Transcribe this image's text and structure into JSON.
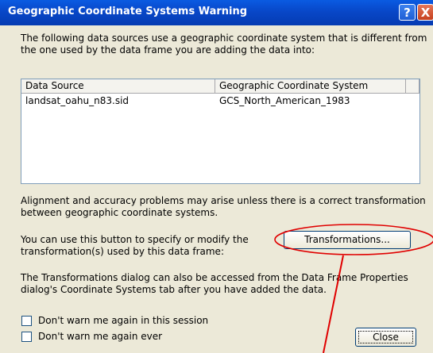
{
  "dialog": {
    "title": "Geographic Coordinate Systems Warning",
    "help_glyph": "?",
    "close_glyph": "X"
  },
  "intro_line1": "The following data sources use a geographic coordinate system that is different from",
  "intro_line2": "the one used by the data frame you are adding the data into:",
  "table": {
    "headers": [
      "Data Source",
      "Geographic Coordinate System"
    ],
    "rows": [
      [
        "landsat_oahu_n83.sid",
        "GCS_North_American_1983"
      ]
    ]
  },
  "alignment_line1": "Alignment and accuracy problems may arise unless there is a correct transformation",
  "alignment_line2": "between geographic coordinate systems.",
  "specify_line1": "You can use this button to specify or modify the",
  "specify_line2": "transformation(s) used by this data frame:",
  "transformations_button": "Transformations...",
  "access_line1": "The Transformations dialog can also be accessed from the Data Frame Properties",
  "access_line2": "dialog's Coordinate Systems tab after you have added the data.",
  "checkboxes": [
    {
      "label": "Don't warn me again in this session",
      "checked": false
    },
    {
      "label": "Don't warn me again ever",
      "checked": false
    }
  ],
  "close_button": "Close",
  "annotation_color": "#e00000"
}
